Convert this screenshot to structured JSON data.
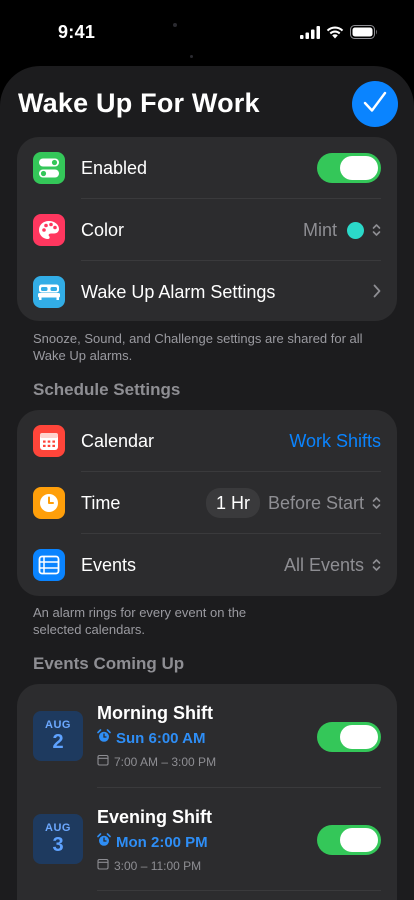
{
  "status_bar": {
    "time": "9:41"
  },
  "header": {
    "title": "Wake Up For Work"
  },
  "general": {
    "enabled_label": "Enabled",
    "enabled_on": true,
    "color_label": "Color",
    "color_value": "Mint",
    "color_swatch": "#2bd9c9",
    "alarm_settings_label": "Wake Up Alarm Settings"
  },
  "general_footnote": "Snooze, Sound, and Challenge settings are shared for all Wake Up alarms.",
  "schedule": {
    "header": "Schedule Settings",
    "calendar_label": "Calendar",
    "calendar_value": "Work Shifts",
    "time_label": "Time",
    "time_offset": "1 Hr",
    "time_relation": "Before Start",
    "events_label": "Events",
    "events_value": "All Events"
  },
  "schedule_footnote": "An alarm rings for every event on the selected calendars.",
  "upcoming": {
    "header": "Events Coming Up",
    "events": [
      {
        "month": "AUG",
        "day": "2",
        "title": "Morning Shift",
        "alarm": "Sun 6:00 AM",
        "range": "7:00 AM – 3:00 PM",
        "on": true
      },
      {
        "month": "AUG",
        "day": "3",
        "title": "Evening Shift",
        "alarm": "Mon 2:00 PM",
        "range": "3:00 – 11:00 PM",
        "on": true
      }
    ]
  },
  "colors": {
    "accent": "#0a84ff",
    "toggle_on": "#34c759",
    "icon_enabled": "#34c759",
    "icon_color": "#ff375f",
    "icon_alarm": "#32ade6",
    "icon_calendar": "#ff453a",
    "icon_time": "#ff9f0a",
    "icon_events": "#0a84ff"
  }
}
